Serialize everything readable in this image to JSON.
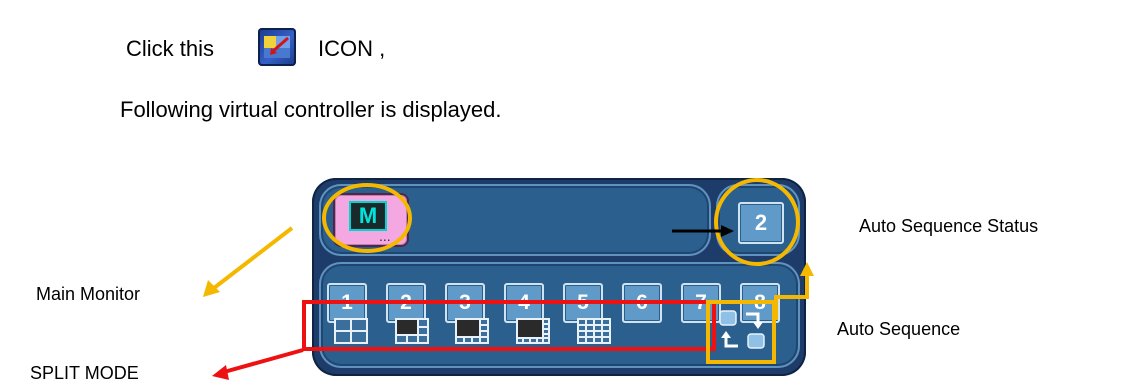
{
  "instructions": {
    "click_prefix": "Click this",
    "click_suffix": "ICON ,",
    "description": "Following virtual controller is displayed."
  },
  "icons": {
    "app_icon": "virtual-controller-icon",
    "monitor_icon": "main-monitor-icon",
    "auto_sequence_icon": "auto-sequence-icon"
  },
  "controller": {
    "monitor_letter": "M",
    "monitor_dots": "...",
    "sequence_status_value": "2",
    "channel_buttons": [
      "1",
      "2",
      "3",
      "4",
      "5",
      "6",
      "7",
      "8"
    ],
    "split_modes": [
      "split-4-icon",
      "split-6-icon",
      "split-8-icon",
      "split-10-icon",
      "split-16-icon"
    ]
  },
  "annotations": {
    "main_monitor": "Main Monitor",
    "auto_sequence_status": "Auto Sequence Status",
    "auto_sequence": "Auto Sequence",
    "split_mode": "SPLIT MODE"
  },
  "colors": {
    "highlight_yellow": "#f5b800",
    "highlight_red": "#ee1111",
    "panel_blue": "#2b5f8e",
    "button_blue": "#5f9ac8",
    "monitor_pink": "#f4a8e2"
  }
}
